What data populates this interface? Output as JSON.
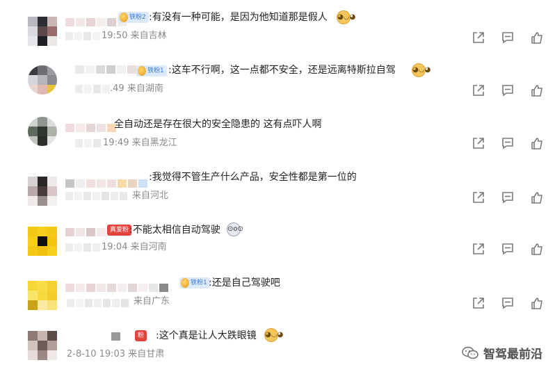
{
  "comments": [
    {
      "badge": "铁粉2",
      "text": ":有没有一种可能，是因为他知道那是假人",
      "time": "19:50",
      "location": "来自吉林",
      "emoji": "doge"
    },
    {
      "badge": "铁粉1",
      "text": ":这车不行啊，这一点都不安全，还是远离特斯拉自驾",
      "time": ".49",
      "location": "来自湖南",
      "emoji": "doge"
    },
    {
      "badge": "",
      "text": "全自动还是存在很大的安全隐患的 这有点吓人啊",
      "time": "19:49",
      "location": "来自黑龙江",
      "emoji": ""
    },
    {
      "badge": "",
      "text": ":我觉得不管生产什么产品，安全性都是第一位的",
      "time": "",
      "location": "来自河北",
      "emoji": ""
    },
    {
      "badge": "真爱粉",
      "text": ":不能太相信自动驾驶",
      "time": "19:04",
      "location": "来自河南",
      "emoji": "kid"
    },
    {
      "badge": "铁粉1",
      "text": ":还是自己驾驶吧",
      "time": "",
      "location": "来自广东",
      "emoji": ""
    },
    {
      "badge": "粉",
      "text": ":这个真是让人大跌眼镜",
      "time": "2-8-10 19:03",
      "location": "来自甘肃",
      "emoji": "doge"
    }
  ],
  "icons": {
    "share": "share-icon",
    "comment": "comment-icon",
    "like": "like-icon"
  },
  "watermark": {
    "text": "智驾最前沿"
  },
  "colors": {
    "badge_blue": "#dbe9fb",
    "badge_red": "#e8423f",
    "meta_gray": "#8a8a8a"
  }
}
